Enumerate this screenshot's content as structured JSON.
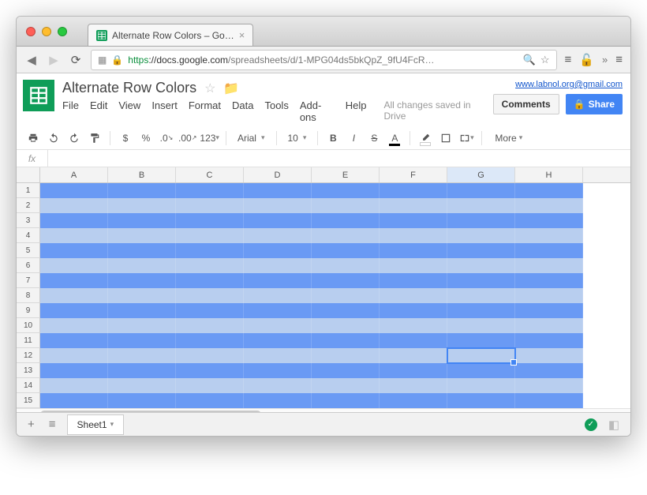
{
  "browser": {
    "tab_title": "Alternate Row Colors – Go…",
    "url_proto": "https",
    "url_host": "://docs.google.com",
    "url_path": "/spreadsheets/d/1-MPG04ds5bkQpZ_9fU4FcR…"
  },
  "doc": {
    "title": "Alternate Row Colors",
    "save_state": "All changes saved in Drive",
    "account_email": "www.labnol.org@gmail.com",
    "comments_label": "Comments",
    "share_label": "Share"
  },
  "menus": [
    "File",
    "Edit",
    "View",
    "Insert",
    "Format",
    "Data",
    "Tools",
    "Add-ons",
    "Help"
  ],
  "toolbar": {
    "font": "Arial",
    "font_size": "10",
    "more_label": "More"
  },
  "fx_label": "fx",
  "columns": [
    "A",
    "B",
    "C",
    "D",
    "E",
    "F",
    "G",
    "H"
  ],
  "rows": [
    1,
    2,
    3,
    4,
    5,
    6,
    7,
    8,
    9,
    10,
    11,
    12,
    13,
    14,
    15
  ],
  "selected_column": "G",
  "selected_row": 12,
  "sheet_tab": "Sheet1",
  "row_color_odd": "#6a9af4",
  "row_color_even": "#b8ceef"
}
